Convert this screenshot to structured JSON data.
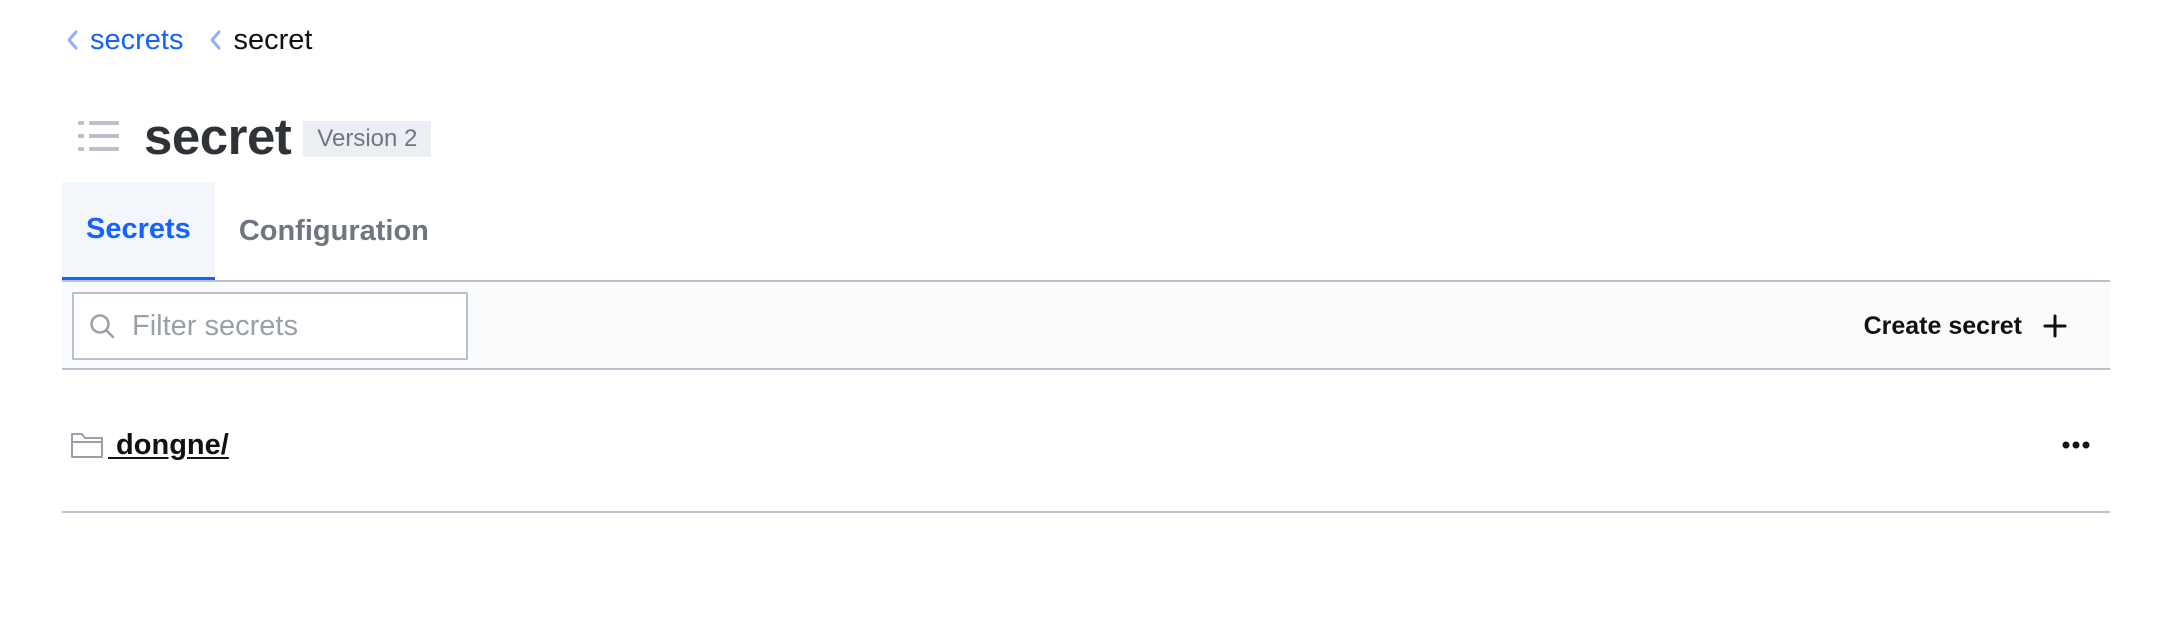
{
  "breadcrumb": {
    "items": [
      {
        "label": "secrets"
      },
      {
        "label": "secret"
      }
    ]
  },
  "header": {
    "title": "secret",
    "version": "Version 2",
    "icon": "list-icon"
  },
  "tabs": [
    {
      "label": "Secrets",
      "active": true
    },
    {
      "label": "Configuration",
      "active": false
    }
  ],
  "toolbar": {
    "filter_placeholder": "Filter secrets",
    "filter_value": "",
    "create_label": "Create secret"
  },
  "secrets": [
    {
      "name": " dongne/",
      "type": "folder",
      "icon": "folder-icon"
    }
  ],
  "colors": {
    "accent": "#1563ff",
    "border": "#bac1cc",
    "muted_text": "#6f7682",
    "badge_bg": "#ebeef2"
  }
}
